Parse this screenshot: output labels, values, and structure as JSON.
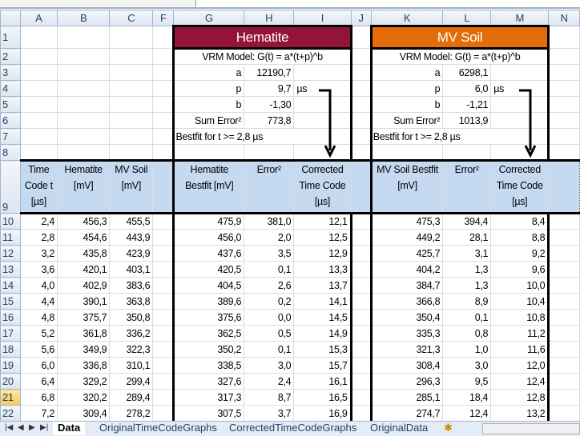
{
  "columns": [
    "A",
    "B",
    "C",
    "F",
    "G",
    "H",
    "I",
    "J",
    "K",
    "L",
    "M",
    "N"
  ],
  "selected_row": "21",
  "hematite": {
    "title": "Hematite",
    "color": "#941338",
    "model": "VRM Model:  G(t) = a*(t+p)^b",
    "a_label": "a",
    "a": "12190,7",
    "p_label": "p",
    "p": "9,7",
    "p_unit": "µs",
    "b_label": "b",
    "b": "-1,30",
    "sum_label": "Sum Error²",
    "sum": "773,8",
    "bestfit": "Bestfit for t >= 2,8 µs"
  },
  "mvsoil": {
    "title": "MV Soil",
    "color": "#e46c0a",
    "model": "VRM Model:  G(t) = a*(t+p)^b",
    "a_label": "a",
    "a": "6298,1",
    "p_label": "p",
    "p": "6,0",
    "p_unit": "µs",
    "b_label": "b",
    "b": "-1,21",
    "sum_label": "Sum Error²",
    "sum": "1013,9",
    "bestfit": "Bestfit for t >= 2,8 µs"
  },
  "headers": [
    "Time Code t [µs]",
    "Hematite [mV]",
    "MV Soil [mV]",
    "",
    "Hematite Bestfit [mV]",
    "Error²",
    "Corrected Time Code [µs]",
    "",
    "MV Soil Bestfit [mV]",
    "Error²",
    "Corrected Time Code [µs]",
    ""
  ],
  "rows": [
    [
      "10",
      "2,4",
      "456,3",
      "455,5",
      "475,9",
      "381,0",
      "12,1",
      "475,3",
      "394,4",
      "8,4"
    ],
    [
      "11",
      "2,8",
      "454,6",
      "443,9",
      "456,0",
      "2,0",
      "12,5",
      "449,2",
      "28,1",
      "8,8"
    ],
    [
      "12",
      "3,2",
      "435,8",
      "423,9",
      "437,6",
      "3,5",
      "12,9",
      "425,7",
      "3,1",
      "9,2"
    ],
    [
      "13",
      "3,6",
      "420,1",
      "403,1",
      "420,5",
      "0,1",
      "13,3",
      "404,2",
      "1,3",
      "9,6"
    ],
    [
      "14",
      "4,0",
      "402,9",
      "383,6",
      "404,5",
      "2,6",
      "13,7",
      "384,7",
      "1,3",
      "10,0"
    ],
    [
      "15",
      "4,4",
      "390,1",
      "363,8",
      "389,6",
      "0,2",
      "14,1",
      "366,8",
      "8,9",
      "10,4"
    ],
    [
      "16",
      "4,8",
      "375,7",
      "350,8",
      "375,6",
      "0,0",
      "14,5",
      "350,4",
      "0,1",
      "10,8"
    ],
    [
      "17",
      "5,2",
      "361,8",
      "336,2",
      "362,5",
      "0,5",
      "14,9",
      "335,3",
      "0,8",
      "11,2"
    ],
    [
      "18",
      "5,6",
      "349,9",
      "322,3",
      "350,2",
      "0,1",
      "15,3",
      "321,3",
      "1,0",
      "11,6"
    ],
    [
      "19",
      "6,0",
      "336,8",
      "310,1",
      "338,5",
      "3,0",
      "15,7",
      "308,4",
      "3,0",
      "12,0"
    ],
    [
      "20",
      "6,4",
      "329,2",
      "299,4",
      "327,6",
      "2,4",
      "16,1",
      "296,3",
      "9,5",
      "12,4"
    ],
    [
      "21",
      "6,8",
      "320,2",
      "289,4",
      "317,3",
      "8,7",
      "16,5",
      "285,1",
      "18,4",
      "12,8"
    ],
    [
      "22",
      "7,2",
      "309,4",
      "278,2",
      "307,5",
      "3,7",
      "16,9",
      "274,7",
      "12,4",
      "13,2"
    ]
  ],
  "tabs": [
    "Data",
    "OriginalTimeCodeGraphs",
    "CorrectedTimeCodeGraphs",
    "OriginalData"
  ],
  "active_tab": "Data"
}
